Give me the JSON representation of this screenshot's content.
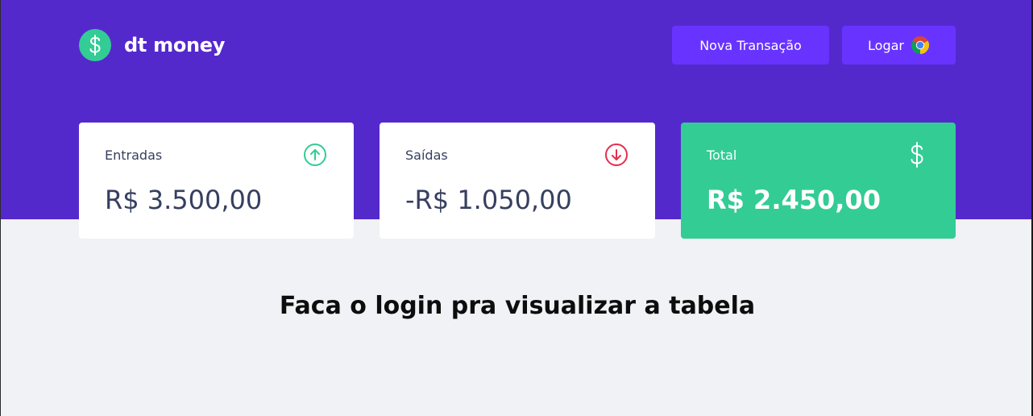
{
  "app": {
    "name": "dt money",
    "logo_icon": "dollar-icon"
  },
  "header": {
    "new_transaction_label": "Nova Transação",
    "login_label": "Logar",
    "login_icon": "chrome-icon"
  },
  "summary": {
    "income": {
      "title": "Entradas",
      "value": "R$ 3.500,00",
      "icon": "arrow-up-circle-icon",
      "color": "#33cc95"
    },
    "outcome": {
      "title": "Saídas",
      "value": "-R$ 1.050,00",
      "icon": "arrow-down-circle-icon",
      "color": "#e52e4d"
    },
    "total": {
      "title": "Total",
      "value": "R$ 2.450,00",
      "icon": "dollar-icon",
      "color": "#33cc95"
    }
  },
  "main": {
    "message": "Faca o login pra visualizar a tabela"
  },
  "colors": {
    "header": "#5429cc",
    "button": "#6933ff",
    "background": "#f0f2f5",
    "text": "#363f5f"
  }
}
